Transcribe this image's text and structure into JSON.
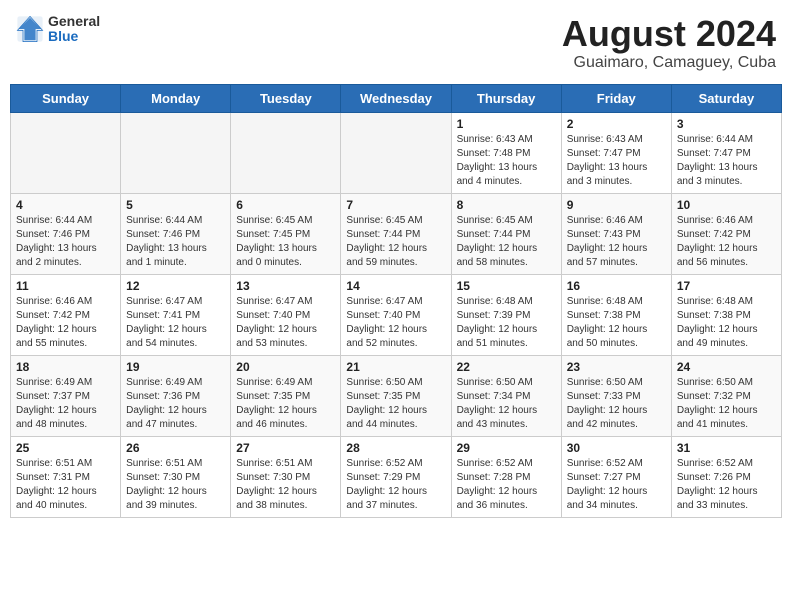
{
  "header": {
    "logo_line1": "General",
    "logo_line2": "Blue",
    "title": "August 2024",
    "subtitle": "Guaimaro, Camaguey, Cuba"
  },
  "weekdays": [
    "Sunday",
    "Monday",
    "Tuesday",
    "Wednesday",
    "Thursday",
    "Friday",
    "Saturday"
  ],
  "weeks": [
    [
      {
        "day": "",
        "info": ""
      },
      {
        "day": "",
        "info": ""
      },
      {
        "day": "",
        "info": ""
      },
      {
        "day": "",
        "info": ""
      },
      {
        "day": "1",
        "info": "Sunrise: 6:43 AM\nSunset: 7:48 PM\nDaylight: 13 hours\nand 4 minutes."
      },
      {
        "day": "2",
        "info": "Sunrise: 6:43 AM\nSunset: 7:47 PM\nDaylight: 13 hours\nand 3 minutes."
      },
      {
        "day": "3",
        "info": "Sunrise: 6:44 AM\nSunset: 7:47 PM\nDaylight: 13 hours\nand 3 minutes."
      }
    ],
    [
      {
        "day": "4",
        "info": "Sunrise: 6:44 AM\nSunset: 7:46 PM\nDaylight: 13 hours\nand 2 minutes."
      },
      {
        "day": "5",
        "info": "Sunrise: 6:44 AM\nSunset: 7:46 PM\nDaylight: 13 hours\nand 1 minute."
      },
      {
        "day": "6",
        "info": "Sunrise: 6:45 AM\nSunset: 7:45 PM\nDaylight: 13 hours\nand 0 minutes."
      },
      {
        "day": "7",
        "info": "Sunrise: 6:45 AM\nSunset: 7:44 PM\nDaylight: 12 hours\nand 59 minutes."
      },
      {
        "day": "8",
        "info": "Sunrise: 6:45 AM\nSunset: 7:44 PM\nDaylight: 12 hours\nand 58 minutes."
      },
      {
        "day": "9",
        "info": "Sunrise: 6:46 AM\nSunset: 7:43 PM\nDaylight: 12 hours\nand 57 minutes."
      },
      {
        "day": "10",
        "info": "Sunrise: 6:46 AM\nSunset: 7:42 PM\nDaylight: 12 hours\nand 56 minutes."
      }
    ],
    [
      {
        "day": "11",
        "info": "Sunrise: 6:46 AM\nSunset: 7:42 PM\nDaylight: 12 hours\nand 55 minutes."
      },
      {
        "day": "12",
        "info": "Sunrise: 6:47 AM\nSunset: 7:41 PM\nDaylight: 12 hours\nand 54 minutes."
      },
      {
        "day": "13",
        "info": "Sunrise: 6:47 AM\nSunset: 7:40 PM\nDaylight: 12 hours\nand 53 minutes."
      },
      {
        "day": "14",
        "info": "Sunrise: 6:47 AM\nSunset: 7:40 PM\nDaylight: 12 hours\nand 52 minutes."
      },
      {
        "day": "15",
        "info": "Sunrise: 6:48 AM\nSunset: 7:39 PM\nDaylight: 12 hours\nand 51 minutes."
      },
      {
        "day": "16",
        "info": "Sunrise: 6:48 AM\nSunset: 7:38 PM\nDaylight: 12 hours\nand 50 minutes."
      },
      {
        "day": "17",
        "info": "Sunrise: 6:48 AM\nSunset: 7:38 PM\nDaylight: 12 hours\nand 49 minutes."
      }
    ],
    [
      {
        "day": "18",
        "info": "Sunrise: 6:49 AM\nSunset: 7:37 PM\nDaylight: 12 hours\nand 48 minutes."
      },
      {
        "day": "19",
        "info": "Sunrise: 6:49 AM\nSunset: 7:36 PM\nDaylight: 12 hours\nand 47 minutes."
      },
      {
        "day": "20",
        "info": "Sunrise: 6:49 AM\nSunset: 7:35 PM\nDaylight: 12 hours\nand 46 minutes."
      },
      {
        "day": "21",
        "info": "Sunrise: 6:50 AM\nSunset: 7:35 PM\nDaylight: 12 hours\nand 44 minutes."
      },
      {
        "day": "22",
        "info": "Sunrise: 6:50 AM\nSunset: 7:34 PM\nDaylight: 12 hours\nand 43 minutes."
      },
      {
        "day": "23",
        "info": "Sunrise: 6:50 AM\nSunset: 7:33 PM\nDaylight: 12 hours\nand 42 minutes."
      },
      {
        "day": "24",
        "info": "Sunrise: 6:50 AM\nSunset: 7:32 PM\nDaylight: 12 hours\nand 41 minutes."
      }
    ],
    [
      {
        "day": "25",
        "info": "Sunrise: 6:51 AM\nSunset: 7:31 PM\nDaylight: 12 hours\nand 40 minutes."
      },
      {
        "day": "26",
        "info": "Sunrise: 6:51 AM\nSunset: 7:30 PM\nDaylight: 12 hours\nand 39 minutes."
      },
      {
        "day": "27",
        "info": "Sunrise: 6:51 AM\nSunset: 7:30 PM\nDaylight: 12 hours\nand 38 minutes."
      },
      {
        "day": "28",
        "info": "Sunrise: 6:52 AM\nSunset: 7:29 PM\nDaylight: 12 hours\nand 37 minutes."
      },
      {
        "day": "29",
        "info": "Sunrise: 6:52 AM\nSunset: 7:28 PM\nDaylight: 12 hours\nand 36 minutes."
      },
      {
        "day": "30",
        "info": "Sunrise: 6:52 AM\nSunset: 7:27 PM\nDaylight: 12 hours\nand 34 minutes."
      },
      {
        "day": "31",
        "info": "Sunrise: 6:52 AM\nSunset: 7:26 PM\nDaylight: 12 hours\nand 33 minutes."
      }
    ]
  ]
}
